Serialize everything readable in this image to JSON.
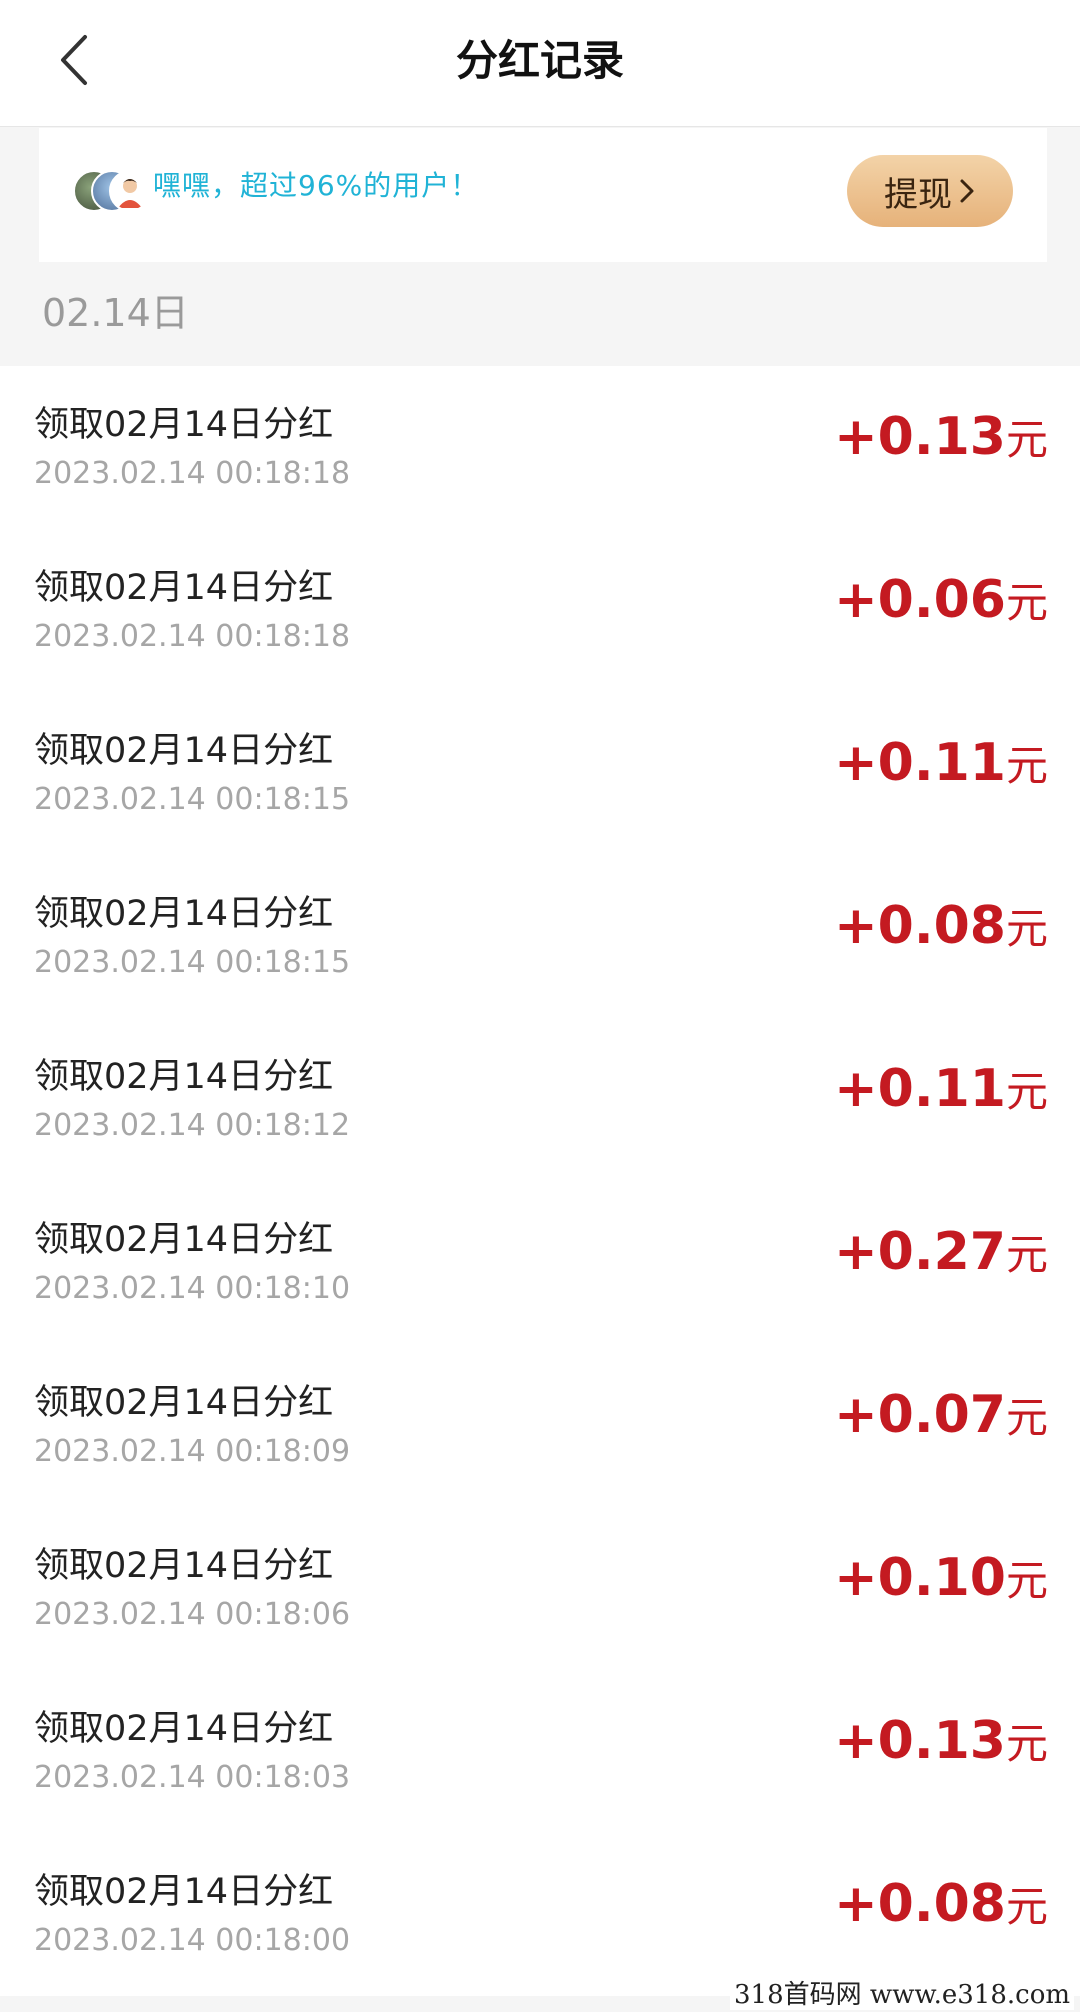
{
  "header": {
    "title": "分红记录",
    "back_icon": "chevron-left-icon"
  },
  "banner": {
    "message": "嘿嘿，超过96%的用户！",
    "withdraw_label": "提现",
    "withdraw_icon": "chevron-right-icon",
    "text_color": "#20b3d6"
  },
  "date_header": "02.14日",
  "records": [
    {
      "title": "领取02月14日分红",
      "time": "2023.02.14 00:18:18",
      "amount": "+0.13",
      "unit": "元"
    },
    {
      "title": "领取02月14日分红",
      "time": "2023.02.14 00:18:18",
      "amount": "+0.06",
      "unit": "元"
    },
    {
      "title": "领取02月14日分红",
      "time": "2023.02.14 00:18:15",
      "amount": "+0.11",
      "unit": "元"
    },
    {
      "title": "领取02月14日分红",
      "time": "2023.02.14 00:18:15",
      "amount": "+0.08",
      "unit": "元"
    },
    {
      "title": "领取02月14日分红",
      "time": "2023.02.14 00:18:12",
      "amount": "+0.11",
      "unit": "元"
    },
    {
      "title": "领取02月14日分红",
      "time": "2023.02.14 00:18:10",
      "amount": "+0.27",
      "unit": "元"
    },
    {
      "title": "领取02月14日分红",
      "time": "2023.02.14 00:18:09",
      "amount": "+0.07",
      "unit": "元"
    },
    {
      "title": "领取02月14日分红",
      "time": "2023.02.14 00:18:06",
      "amount": "+0.10",
      "unit": "元"
    },
    {
      "title": "领取02月14日分红",
      "time": "2023.02.14 00:18:03",
      "amount": "+0.13",
      "unit": "元"
    },
    {
      "title": "领取02月14日分红",
      "time": "2023.02.14 00:18:00",
      "amount": "+0.08",
      "unit": "元"
    }
  ],
  "colors": {
    "amount": "#c41a21",
    "accent_button": "#e6b27a"
  },
  "watermark": "318首码网  www.e318.com"
}
